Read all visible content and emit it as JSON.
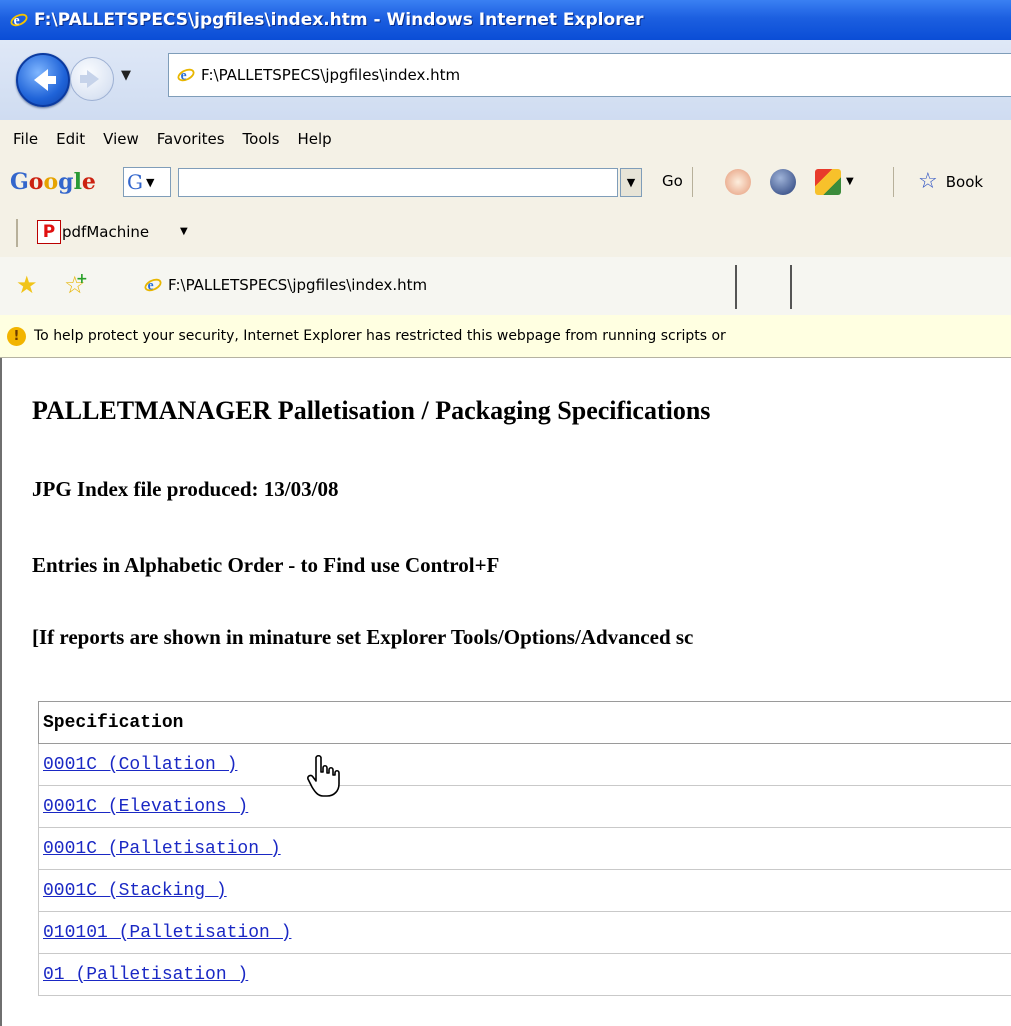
{
  "window": {
    "title": "F:\\PALLETSPECS\\jpgfiles\\index.htm - Windows Internet Explorer"
  },
  "address": {
    "url": "F:\\PALLETSPECS\\jpgfiles\\index.htm"
  },
  "menu": [
    "File",
    "Edit",
    "View",
    "Favorites",
    "Tools",
    "Help"
  ],
  "google_toolbar": {
    "logo": "Google",
    "g_button": "G",
    "go_label": "Go",
    "bookmarks_label": "Book"
  },
  "pdf_toolbar": {
    "label": "pdfMachine"
  },
  "tab": {
    "title": "F:\\PALLETSPECS\\jpgfiles\\index.htm"
  },
  "infobar": {
    "message": "To help protect your security, Internet Explorer has restricted this webpage from running scripts or"
  },
  "page": {
    "heading": "PALLETMANAGER Palletisation / Packaging Specifications",
    "index_line": "JPG Index file produced: 13/03/08",
    "order_line": "Entries in Alphabetic Order - to Find use Control+F",
    "note_line": "[If reports are shown in minature set Explorer Tools/Options/Advanced sc",
    "table_header": "Specification",
    "links": [
      "0001C (Collation )",
      "0001C (Elevations )",
      "0001C (Palletisation )",
      "0001C (Stacking )",
      "010101 (Palletisation )",
      "01 (Palletisation )"
    ]
  },
  "colors": {
    "titlebar": "#0a4dd6",
    "link": "#1a28c4",
    "infobar": "#ffffe1",
    "toolbar": "#f4f1e6"
  }
}
